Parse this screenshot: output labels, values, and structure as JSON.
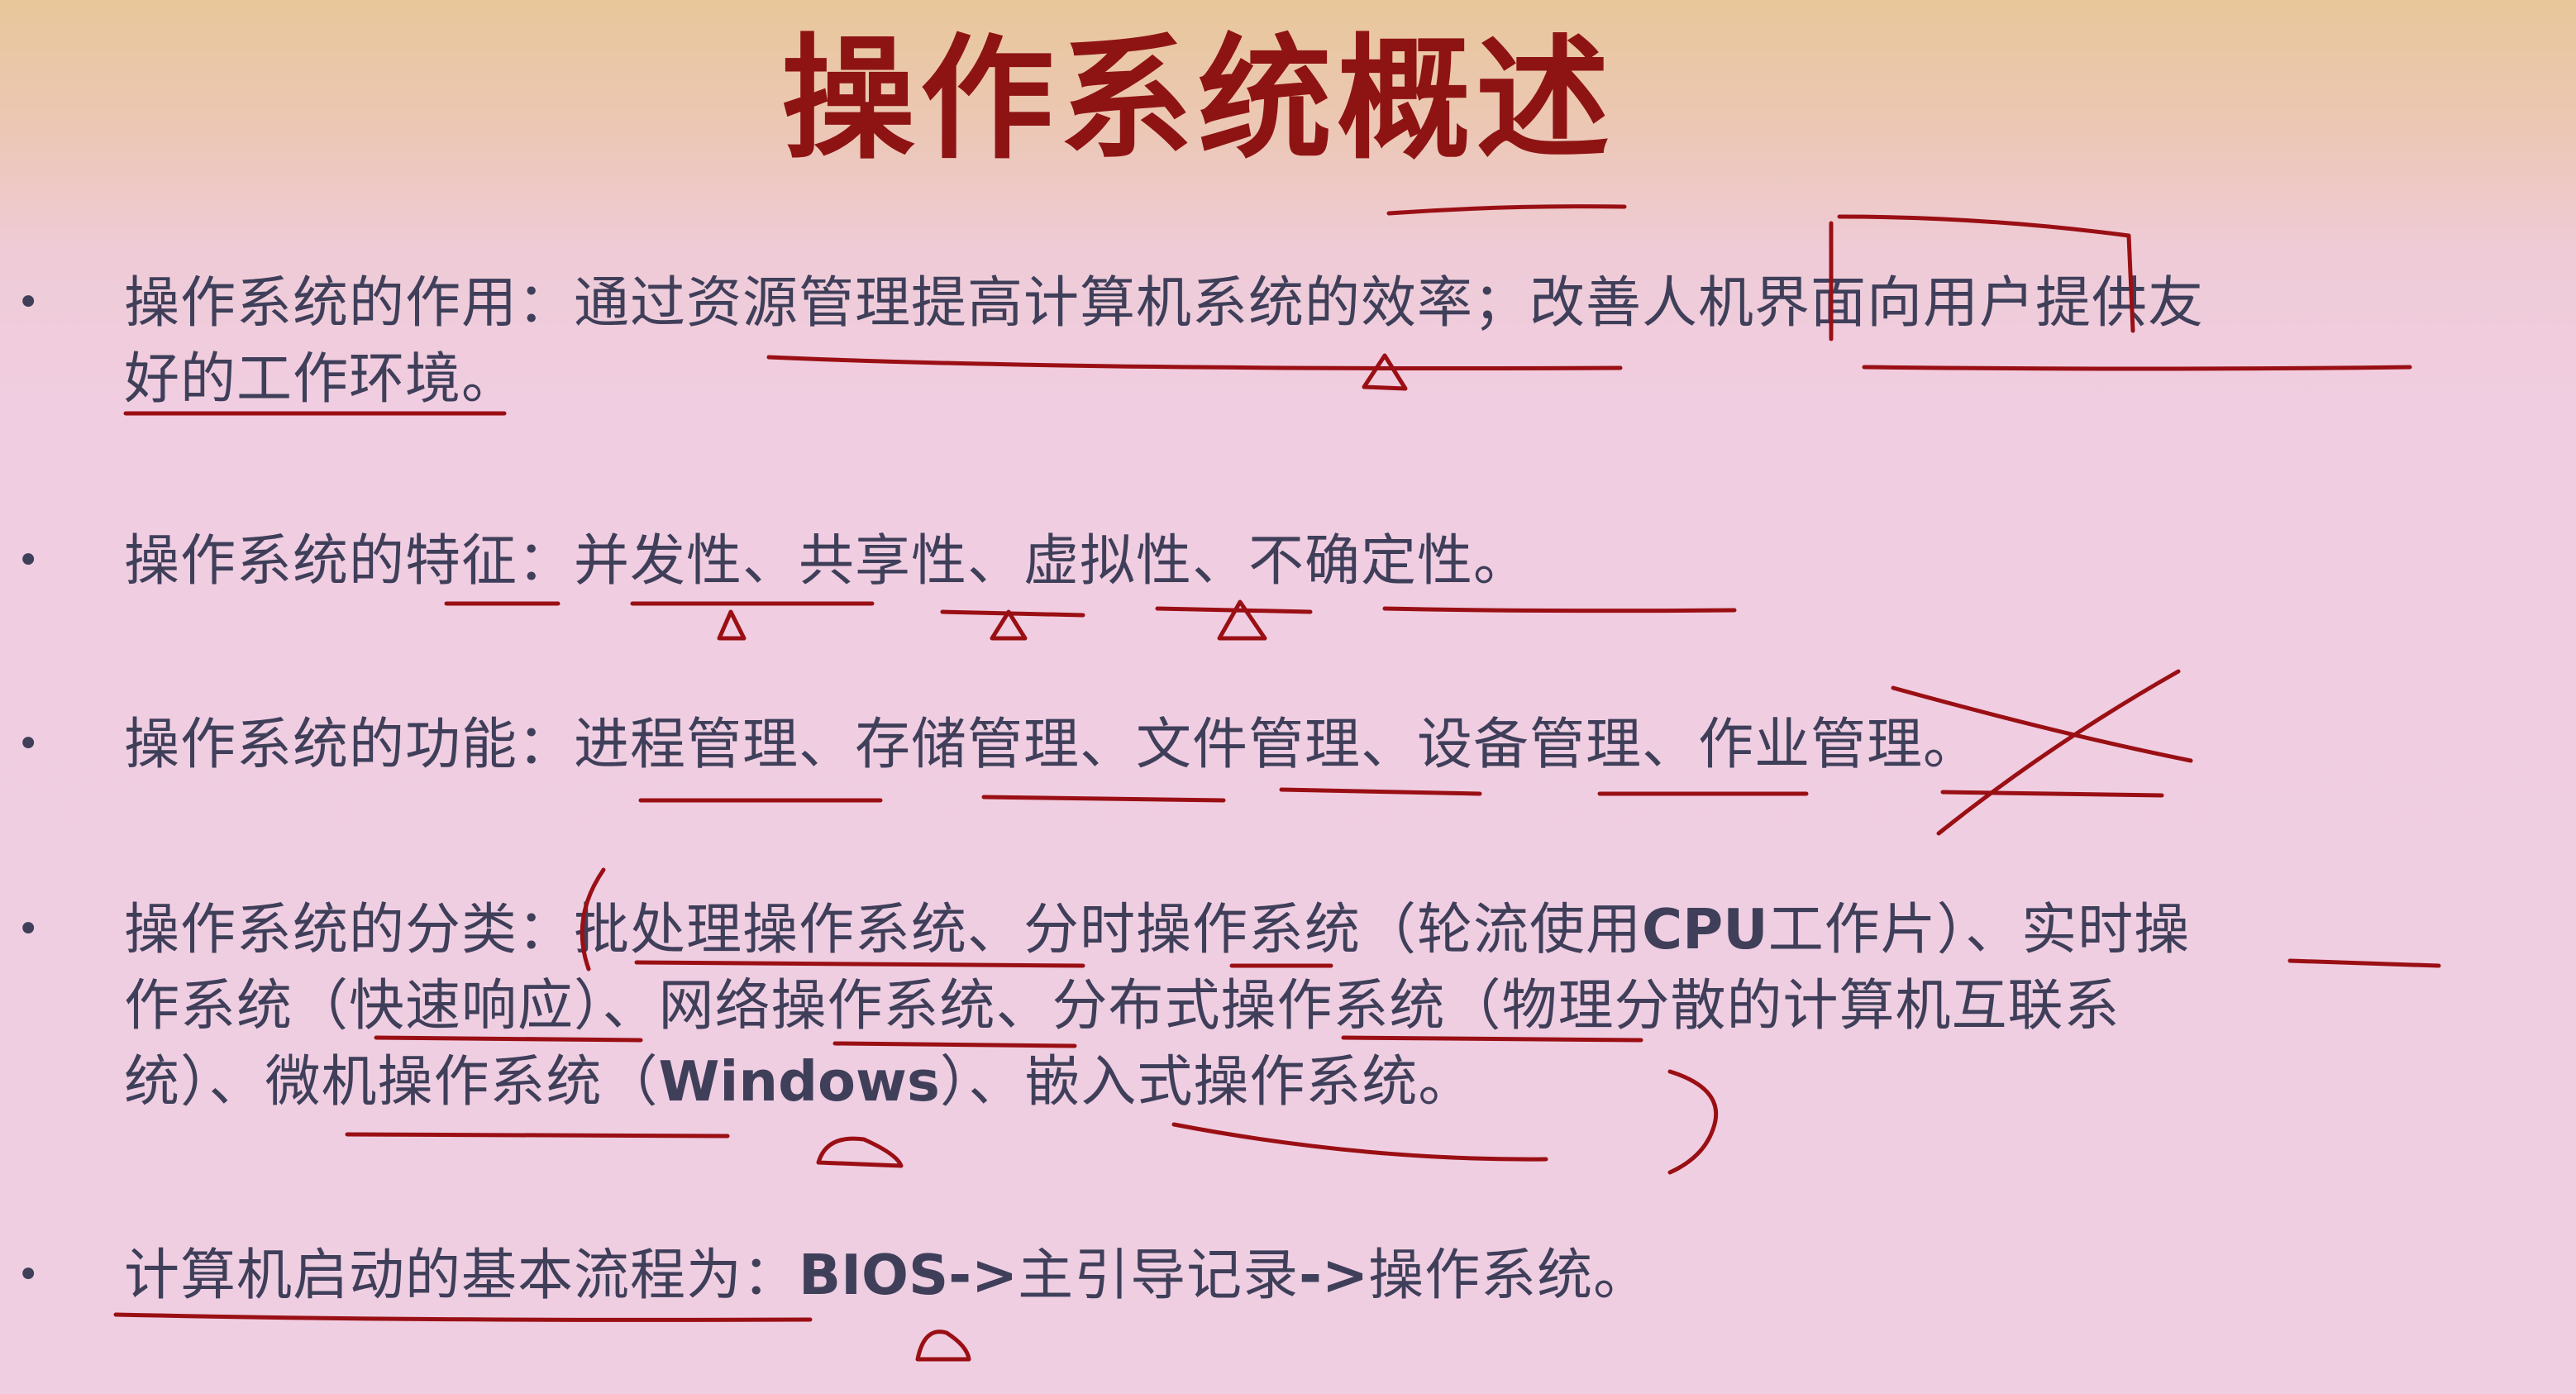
{
  "title": "操作系统概述",
  "items": [
    {
      "bullet": "•",
      "lines": [
        "操作系统的作用：通过资源管理提高计算机系统的效率；改善人机界面向用户提供友",
        "好的工作环境。"
      ]
    },
    {
      "bullet": "•",
      "lines": [
        "操作系统的特征：并发性、共享性、虚拟性、不确定性。"
      ]
    },
    {
      "bullet": "•",
      "lines": [
        "操作系统的功能：进程管理、存储管理、文件管理、设备管理、作业管理。"
      ]
    },
    {
      "bullet": "•",
      "lines": [
        {
          "pre": "操作系统的分类：批处理操作系统、分时操作系统（轮流使用",
          "latin": "CPU",
          "post": "工作片）、实时操"
        },
        "作系统（快速响应）、网络操作系统、分布式操作系统（物理分散的计算机互联系",
        {
          "pre": "统）、微机操作系统（",
          "latin": "Windows",
          "post": "）、嵌入式操作系统。"
        }
      ]
    },
    {
      "bullet": "•",
      "lines": [
        {
          "pre": "计算机启动的基本流程为：",
          "latin": "BIOS->",
          "mid": "主引导记录",
          "latin2": "->",
          "post": "操作系统。"
        }
      ]
    }
  ],
  "annotation_color": "#9a0f14"
}
